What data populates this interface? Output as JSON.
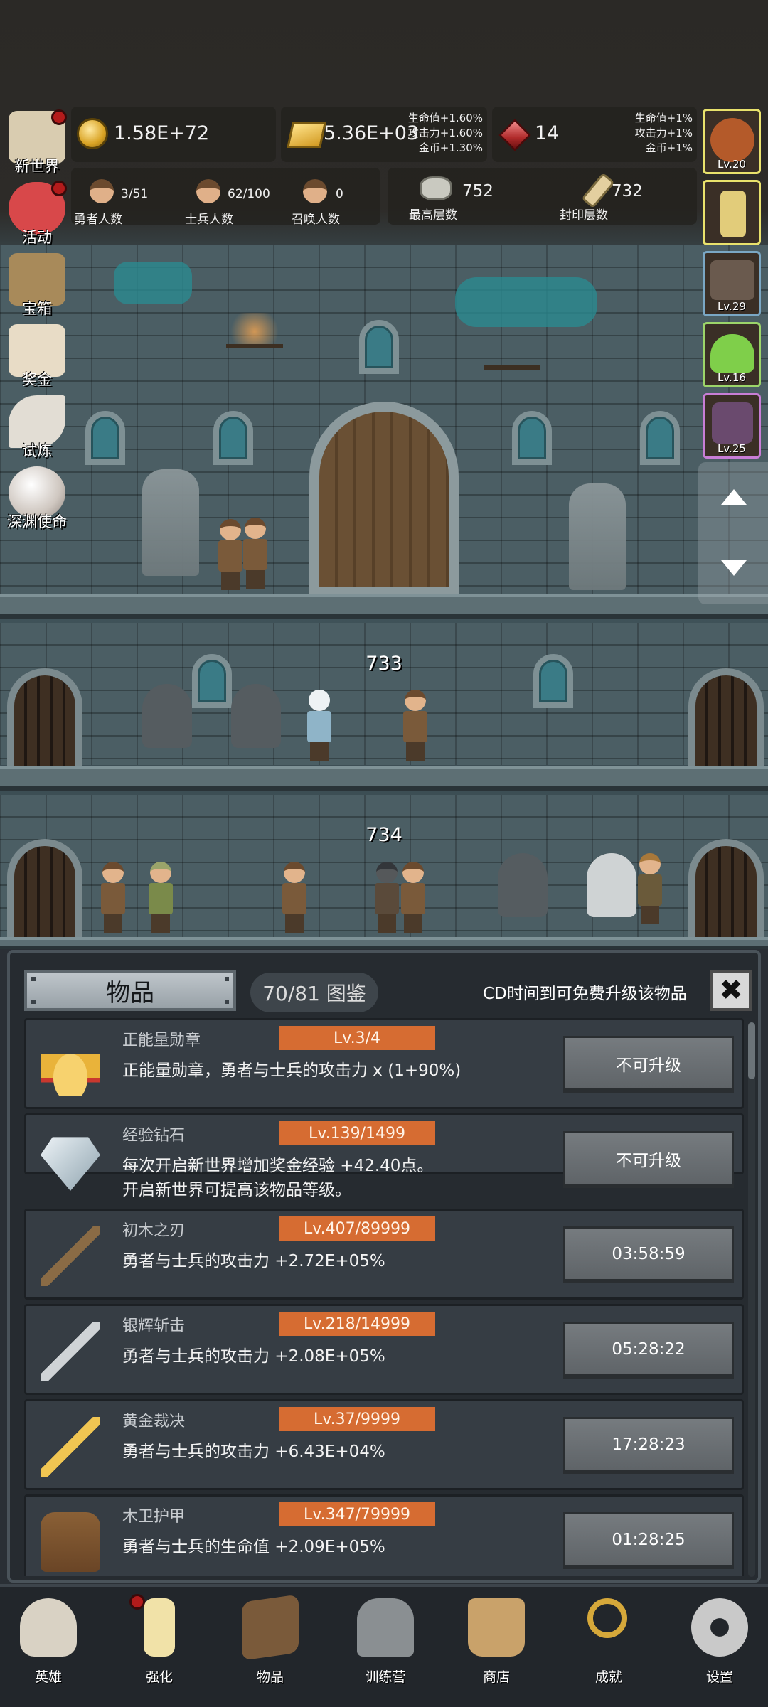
{
  "hud": {
    "gold": "1.58E+72",
    "gold_bars": "5.36E+03",
    "gold_bars_bonus": [
      "生命值+1.60%",
      "攻击力+1.60%",
      "金币+1.30%"
    ],
    "gems": "14",
    "gems_bonus": [
      "生命值+1%",
      "攻击力+1%",
      "金币+1%"
    ],
    "heroes_count": "3/51",
    "heroes_label": "勇者人数",
    "soldiers_count": "62/100",
    "soldiers_label": "士兵人数",
    "summons_count": "0",
    "summons_label": "召唤人数",
    "highest_floor": "752",
    "highest_floor_label": "最高层数",
    "sealed_floor": "732",
    "sealed_floor_label": "封印层数"
  },
  "left_menu": [
    {
      "label": "新世界",
      "icon": "map-icon",
      "dot": true
    },
    {
      "label": "活动",
      "icon": "heart-icon",
      "dot": true
    },
    {
      "label": "宝箱",
      "icon": "chest-icon",
      "dot": false
    },
    {
      "label": "奖金",
      "icon": "envelope-icon",
      "dot": false
    },
    {
      "label": "试炼",
      "icon": "feather-icon",
      "dot": false
    },
    {
      "label": "深渊使命",
      "icon": "pearl-icon",
      "dot": false
    }
  ],
  "right_menu": [
    {
      "lv": "Lv.20",
      "icon": "onion-boss-icon",
      "color": "#b45a2a"
    },
    {
      "lv": "",
      "icon": "candle-icon",
      "color": "#e2cc7a"
    },
    {
      "lv": "Lv.29",
      "icon": "mimic-icon",
      "color": "#6a5a4e"
    },
    {
      "lv": "Lv.16",
      "icon": "slime-icon",
      "color": "#7fcf4a"
    },
    {
      "lv": "Lv.25",
      "icon": "goblin-icon",
      "color": "#6a4a6e"
    }
  ],
  "scene": {
    "floor_a": "733",
    "floor_b": "734"
  },
  "panel": {
    "tab_label": "物品",
    "collection": "70/81 图鉴",
    "cd_hint": "CD时间到可免费升级该物品",
    "close": "✖"
  },
  "items": [
    {
      "name": "正能量勋章",
      "level": "Lv.3/4",
      "desc": "正能量勋章，勇者与士兵的攻击力 x (1+90%)",
      "desc2": "",
      "action": "不可升级",
      "icon": "crown"
    },
    {
      "name": "经验钻石",
      "level": "Lv.139/1499",
      "desc": "每次开启新世界增加奖金经验 +42.40点。",
      "desc2": "开启新世界可提高该物品等级。",
      "action": "不可升级",
      "icon": "diamond"
    },
    {
      "name": "初木之刃",
      "level": "Lv.407/89999",
      "desc": "勇者与士兵的攻击力 +2.72E+05%",
      "desc2": "",
      "action": "03:58:59",
      "icon": "sword"
    },
    {
      "name": "银辉斩击",
      "level": "Lv.218/14999",
      "desc": "勇者与士兵的攻击力 +2.08E+05%",
      "desc2": "",
      "action": "05:28:22",
      "icon": "sword silver"
    },
    {
      "name": "黄金裁决",
      "level": "Lv.37/9999",
      "desc": "勇者与士兵的攻击力 +6.43E+04%",
      "desc2": "",
      "action": "17:28:23",
      "icon": "sword gold"
    },
    {
      "name": "木卫护甲",
      "level": "Lv.347/79999",
      "desc": "勇者与士兵的生命值 +2.09E+05%",
      "desc2": "",
      "action": "01:28:25",
      "icon": "armor"
    }
  ],
  "nav": [
    {
      "label": "英雄",
      "icon": "skull-icon",
      "dot": false,
      "color": "#d9d2c4"
    },
    {
      "label": "强化",
      "icon": "candle-icon",
      "dot": true,
      "color": "#f1e2a8"
    },
    {
      "label": "物品",
      "icon": "book-icon",
      "dot": false,
      "color": "#7a5a3a"
    },
    {
      "label": "训练营",
      "icon": "lantern-icon",
      "dot": false,
      "color": "#8a8f92"
    },
    {
      "label": "商店",
      "icon": "mug-icon",
      "dot": false,
      "color": "#c9a26a"
    },
    {
      "label": "成就",
      "icon": "key-icon",
      "dot": false,
      "color": "#d6a83a"
    },
    {
      "label": "设置",
      "icon": "gear-icon",
      "dot": false,
      "color": "#c9c9c9"
    }
  ]
}
